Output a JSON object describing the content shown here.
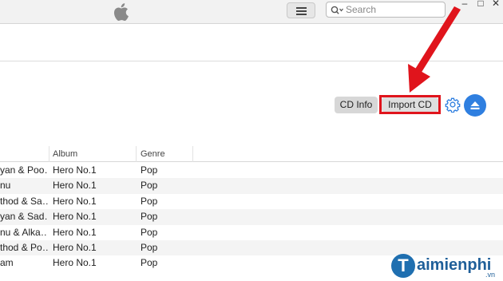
{
  "titlebar": {
    "search_placeholder": "Search",
    "window_controls": {
      "minimize": "–",
      "maximize": "□",
      "close": "✕"
    }
  },
  "actions": {
    "cd_info_label": "CD Info",
    "import_cd_label": "Import CD"
  },
  "table": {
    "headers": {
      "album": "Album",
      "genre": "Genre"
    },
    "rows": [
      {
        "artist": "yan & Poo…",
        "album": "Hero No.1",
        "genre": "Pop"
      },
      {
        "artist": "nu",
        "album": "Hero No.1",
        "genre": "Pop"
      },
      {
        "artist": "thod & Sa…",
        "album": "Hero No.1",
        "genre": "Pop"
      },
      {
        "artist": "yan & Sad…",
        "album": "Hero No.1",
        "genre": "Pop"
      },
      {
        "artist": "nu & Alka…",
        "album": "Hero No.1",
        "genre": "Pop"
      },
      {
        "artist": "thod & Po…",
        "album": "Hero No.1",
        "genre": "Pop"
      },
      {
        "artist": "am",
        "album": "Hero No.1",
        "genre": "Pop"
      }
    ]
  },
  "watermark": {
    "brand": "aimienphi",
    "brand_initial": "T",
    "tld": ".vn"
  },
  "colors": {
    "accent_blue": "#2f7fe0",
    "highlight_red": "#e0141c"
  },
  "icons": [
    "apple-logo",
    "list-icon",
    "search-icon",
    "gear-icon",
    "eject-icon"
  ]
}
